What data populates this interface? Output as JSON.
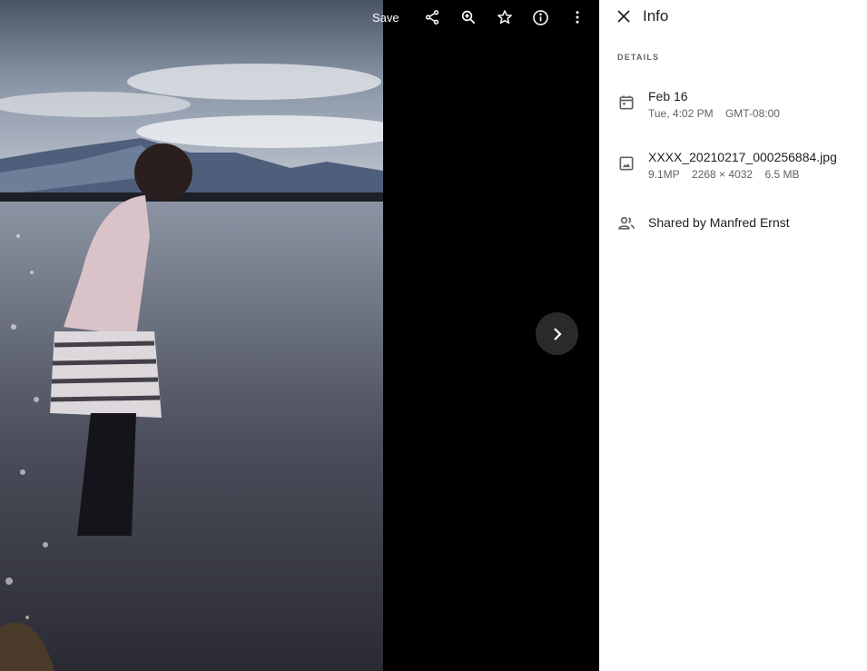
{
  "toolbar": {
    "save_label": "Save",
    "icons": [
      "share-icon",
      "zoom-in-icon",
      "star-icon",
      "info-icon",
      "more-vert-icon"
    ]
  },
  "viewer": {
    "next_icon": "chevron-right-icon",
    "photo_description": "Child in pink sweater and striped skirt standing in lake water, mountains and clouds in background"
  },
  "panel": {
    "title": "Info",
    "section_label": "DETAILS",
    "date": {
      "icon": "calendar-icon",
      "main": "Feb 16",
      "day_time": "Tue, 4:02 PM",
      "timezone": "GMT-08:00"
    },
    "file": {
      "icon": "image-icon",
      "name": "XXXX_20210217_000256884.jpg",
      "megapixels": "9.1MP",
      "dimensions": "2268 × 4032",
      "size": "6.5 MB"
    },
    "shared": {
      "icon": "people-icon",
      "text": "Shared by Manfred Ernst"
    }
  },
  "colors": {
    "viewer_bg": "#000000",
    "panel_bg": "#ffffff",
    "primary_text": "#202124",
    "secondary_text": "#5f6368",
    "next_button_bg": "#2a2a2a"
  }
}
